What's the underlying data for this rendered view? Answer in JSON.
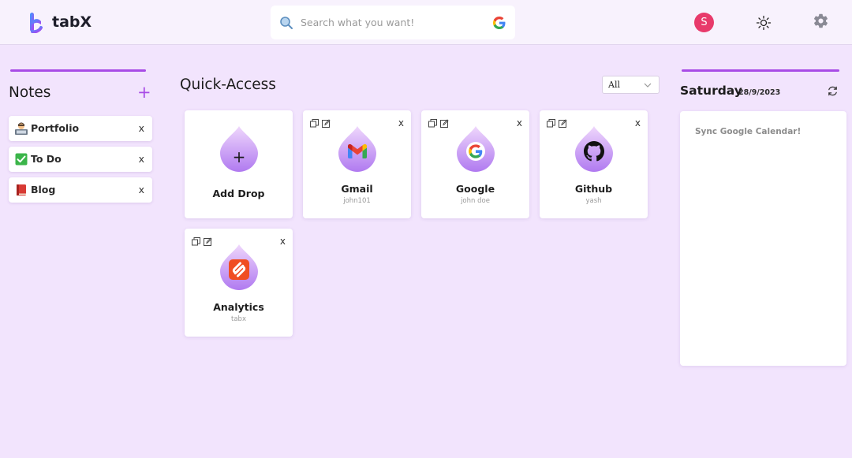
{
  "header": {
    "brand": "tabX",
    "search_placeholder": "Search what you want!",
    "avatar_initial": "S",
    "icons": [
      "tabx-logo-icon",
      "search-icon",
      "google-icon",
      "sun-icon",
      "gear-icon"
    ]
  },
  "notes": {
    "title": "Notes",
    "add_label": "+",
    "items": [
      {
        "label": "Portfolio",
        "emoji": "man-technologist-emoji",
        "close": "x"
      },
      {
        "label": "To Do",
        "emoji": "check-mark-emoji",
        "close": "x"
      },
      {
        "label": "Blog",
        "emoji": "red-book-emoji",
        "close": "x"
      }
    ]
  },
  "quick_access": {
    "title": "Quick-Access",
    "filter": {
      "selected": "All"
    },
    "add_drop": {
      "icon_label": "+",
      "name": "Add Drop"
    },
    "cards": [
      {
        "name": "Gmail",
        "sub": "john101",
        "icon": "gmail-icon",
        "close": "x"
      },
      {
        "name": "Google",
        "sub": "john doe",
        "icon": "google-icon",
        "close": "x"
      },
      {
        "name": "Github",
        "sub": "yash",
        "icon": "github-icon",
        "close": "x"
      },
      {
        "name": "Analytics",
        "sub": "tabx",
        "icon": "analytics-icon",
        "close": "x"
      }
    ]
  },
  "calendar": {
    "day": "Saturday",
    "date": "28/9/2023",
    "sync_text": "Sync Google Calendar!"
  },
  "colors": {
    "background": "#f2e4fd",
    "accent": "#a84be6",
    "drop_gradient_top": "#e8c8fb",
    "drop_gradient_bottom": "#b27af0",
    "avatar": "#e83a6b"
  }
}
